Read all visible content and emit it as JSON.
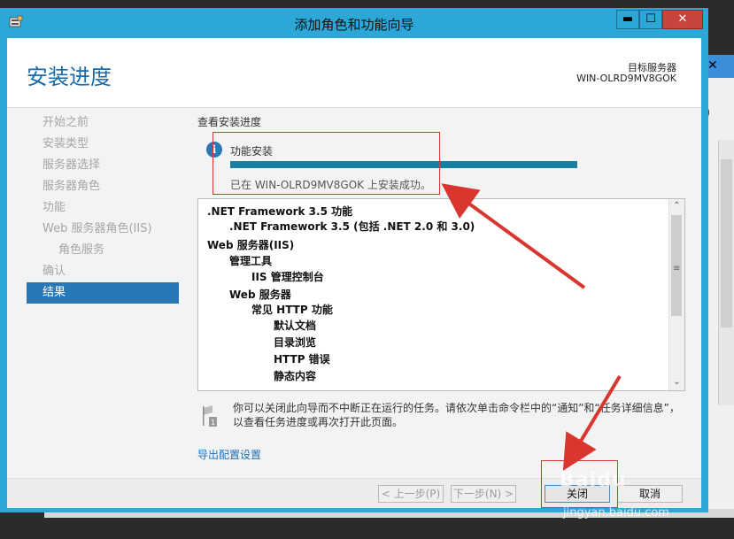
{
  "window": {
    "title": "添加角色和功能向导",
    "min_label": "▬",
    "max_label": "☐",
    "close_label": "✕"
  },
  "header": {
    "page_title": "安装进度",
    "destination_label": "目标服务器",
    "destination_value": "WIN-OLRD9MV8GOK"
  },
  "nav": {
    "items": [
      {
        "label": "开始之前"
      },
      {
        "label": "安装类型"
      },
      {
        "label": "服务器选择"
      },
      {
        "label": "服务器角色"
      },
      {
        "label": "功能"
      },
      {
        "label": "Web 服务器角色(IIS)"
      },
      {
        "label": "角色服务"
      },
      {
        "label": "确认"
      },
      {
        "label": "结果"
      }
    ],
    "active": "结果"
  },
  "content": {
    "section_heading": "查看安装进度",
    "feature_title": "功能安装",
    "progress": 1.0,
    "status": "已在 WIN-OLRD9MV8GOK 上安装成功。",
    "results": [
      {
        "text": ".NET Framework 3.5 功能",
        "level": 0
      },
      {
        "text": ".NET Framework 3.5 (包括 .NET 2.0 和 3.0)",
        "level": 1
      },
      {
        "text": "Web 服务器(IIS)",
        "level": 0
      },
      {
        "text": "管理工具",
        "level": 1
      },
      {
        "text": "IIS 管理控制台",
        "level": 2
      },
      {
        "text": "Web 服务器",
        "level": 1
      },
      {
        "text": "常见 HTTP 功能",
        "level": 2
      },
      {
        "text": "默认文档",
        "level": 3
      },
      {
        "text": "目录浏览",
        "level": 3
      },
      {
        "text": "HTTP 错误",
        "level": 3
      },
      {
        "text": "静态内容",
        "level": 3
      }
    ],
    "note": "你可以关闭此向导而不中断正在运行的任务。请依次单击命令栏中的“通知”和“任务详细信息”，以查看任务进度或再次打开此页面。",
    "export_link": "导出配置设置"
  },
  "buttons": {
    "prev": "< 上一步(P)",
    "next": "下一步(N) >",
    "close": "关闭",
    "cancel": "取消"
  },
  "colors": {
    "window_frame": "#2ba7d8",
    "page_title": "#1a6aa8",
    "nav_active": "#2a77b5",
    "progress_fill": "#1a7ea1",
    "annotation": "#d8362f"
  },
  "watermark": {
    "brand": "Baidu",
    "url": "jingyan.baidu.com"
  }
}
